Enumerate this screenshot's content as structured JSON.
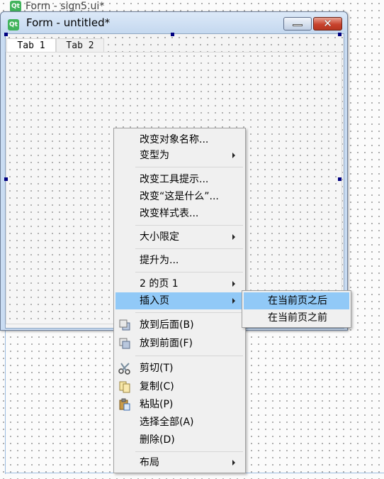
{
  "back_window": {
    "title": "Form - sign5.ui*",
    "icon": "qt-logo-icon"
  },
  "form_window": {
    "title": "Form - untitled*",
    "icon": "qt-logo-icon",
    "icon_text": "Qt",
    "minimize_icon": "minimize-icon",
    "close_icon": "close-icon",
    "close_glyph": "✕"
  },
  "tabs": [
    {
      "label": "Tab 1",
      "selected": true
    },
    {
      "label": "Tab 2",
      "selected": false
    }
  ],
  "context_menu": {
    "items": [
      {
        "label": "改变对象名称...",
        "submenu": false
      },
      {
        "label": "变型为",
        "submenu": true
      },
      {
        "label": "改变工具提示...",
        "submenu": false
      },
      {
        "label": "改变“这是什么”...",
        "submenu": false
      },
      {
        "label": "改变样式表...",
        "submenu": false
      },
      {
        "label": "大小限定",
        "submenu": true
      },
      {
        "label": "提升为...",
        "submenu": false
      },
      {
        "label": "2 的页 1",
        "submenu": true
      },
      {
        "label": "插入页",
        "submenu": true,
        "highlighted": true
      },
      {
        "label": "放到后面(B)",
        "icon": "send-to-back-icon"
      },
      {
        "label": "放到前面(F)",
        "icon": "bring-to-front-icon"
      },
      {
        "label": "剪切(T)",
        "icon": "scissors-icon"
      },
      {
        "label": "复制(C)",
        "icon": "copy-icon"
      },
      {
        "label": "粘贴(P)",
        "icon": "paste-icon"
      },
      {
        "label": "选择全部(A)"
      },
      {
        "label": "删除(D)"
      },
      {
        "label": "布局",
        "submenu": true
      }
    ]
  },
  "insert_page_submenu": {
    "items": [
      {
        "label": "在当前页之后",
        "highlighted": true
      },
      {
        "label": "在当前页之前",
        "highlighted": false
      }
    ]
  },
  "colors": {
    "menu_highlight": "#91c9f7",
    "selection_handle": "#000080",
    "qt_green": "#41b35c"
  }
}
